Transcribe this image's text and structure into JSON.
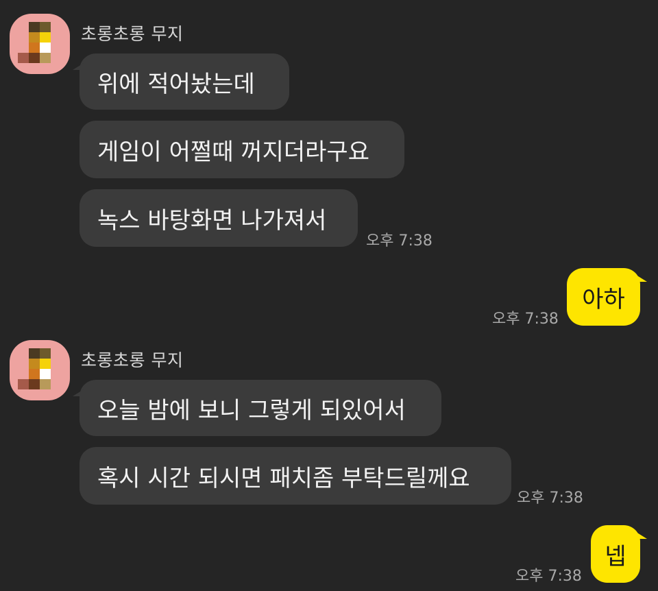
{
  "chat": {
    "groups": [
      {
        "sender": "초롱초롱 무지",
        "messages": [
          "위에 적어놨는데",
          "게임이 어쩔때 꺼지더라구요",
          "녹스 바탕화면 나가져서"
        ],
        "time": "오후 7:38"
      },
      {
        "sender": "초롱초롱 무지",
        "messages": [
          "오늘 밤에 보니 그렇게 되있어서",
          "혹시 시간 되시면 패치좀 부탁드릴께요"
        ],
        "time": "오후 7:38"
      }
    ],
    "my_messages": [
      {
        "text": "아하",
        "time": "오후 7:38"
      },
      {
        "text": "넵",
        "time": "오후 7:38"
      }
    ],
    "colors": {
      "background": "#252525",
      "incoming_bubble": "#3b3b3b",
      "outgoing_bubble": "#fee500",
      "avatar": "#eea3a0"
    }
  }
}
